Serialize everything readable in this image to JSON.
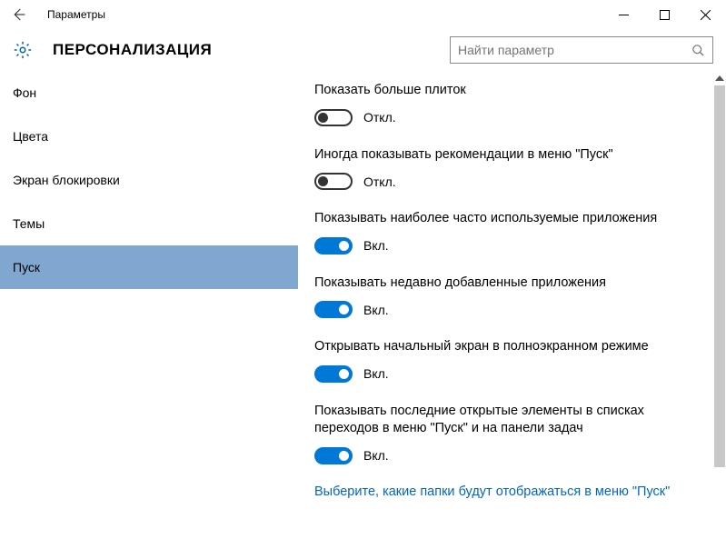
{
  "titlebar": {
    "title": "Параметры"
  },
  "header": {
    "category": "ПЕРСОНАЛИЗАЦИЯ",
    "search_placeholder": "Найти параметр"
  },
  "sidebar": {
    "items": [
      {
        "label": "Фон",
        "selected": false
      },
      {
        "label": "Цвета",
        "selected": false
      },
      {
        "label": "Экран блокировки",
        "selected": false
      },
      {
        "label": "Темы",
        "selected": false
      },
      {
        "label": "Пуск",
        "selected": true
      }
    ]
  },
  "settings": [
    {
      "label": "Показать больше плиток",
      "state": "off",
      "state_text": "Откл."
    },
    {
      "label": "Иногда показывать рекомендации в меню \"Пуск\"",
      "state": "off",
      "state_text": "Откл."
    },
    {
      "label": "Показывать наиболее часто используемые приложения",
      "state": "on",
      "state_text": "Вкл."
    },
    {
      "label": "Показывать недавно добавленные приложения",
      "state": "on",
      "state_text": "Вкл."
    },
    {
      "label": "Открывать начальный экран в полноэкранном режиме",
      "state": "on",
      "state_text": "Вкл."
    },
    {
      "label": "Показывать последние открытые элементы в списках переходов в меню \"Пуск\" и на панели задач",
      "state": "on",
      "state_text": "Вкл."
    }
  ],
  "link": {
    "text": "Выберите, какие папки будут отображаться в меню \"Пуск\""
  }
}
